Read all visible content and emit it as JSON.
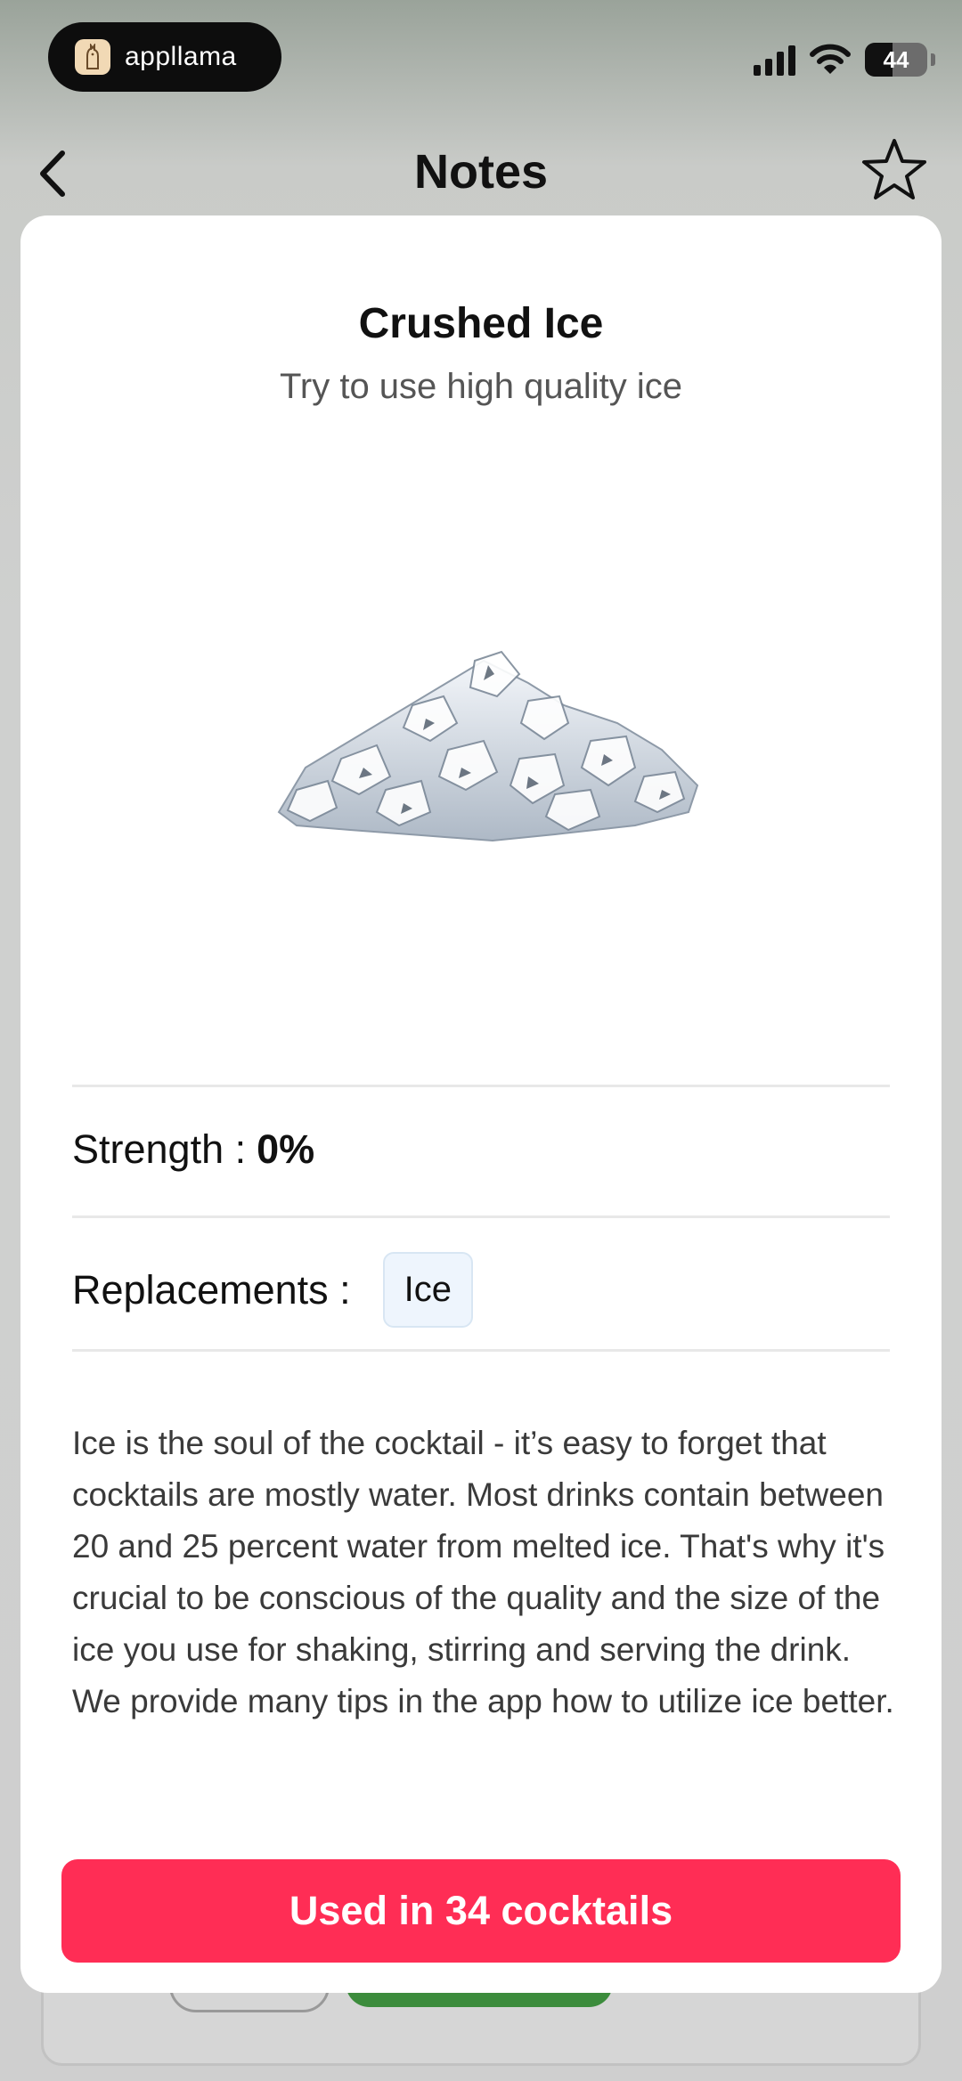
{
  "status_bar": {
    "app_name": "appllama",
    "battery": "44",
    "icons": [
      "signal-icon",
      "wifi-icon",
      "battery-icon"
    ]
  },
  "nav": {
    "title": "Notes",
    "back_icon": "chevron-left-icon",
    "favorite_icon": "star-outline-icon"
  },
  "ingredient": {
    "name": "Crushed Ice",
    "subtitle": "Try to use high quality ice",
    "image_icon": "crushed-ice-image",
    "strength_label": "Strength :",
    "strength_value": "0%",
    "replacements_label": "Replacements :",
    "replacements": [
      "Ice"
    ],
    "description": "Ice is the soul of the cocktail - it’s easy to forget that cocktails are mostly water. Most drinks contain between 20 and 25 percent water from melted ice. That's why it's crucial to be conscious of the quality and the size of the ice you use for shaking, stirring and serving the drink. We provide many tips in the app how to utilize ice better."
  },
  "cta": {
    "label": "Used in 34 cocktails",
    "color": "#ff2d55"
  }
}
